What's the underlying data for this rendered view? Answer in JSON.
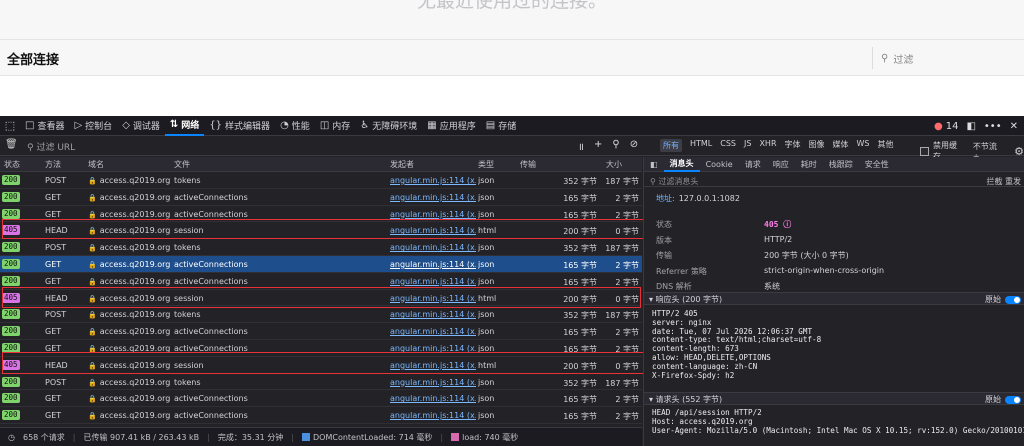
{
  "webpage": {
    "empty_text": "无最近使用过的连接。",
    "section_title": "全部连接",
    "filter_placeholder": "过滤"
  },
  "devtools": {
    "tabs": [
      {
        "icon": "□",
        "label": "查看器"
      },
      {
        "icon": "▷",
        "label": "控制台"
      },
      {
        "icon": "◇",
        "label": "调试器"
      },
      {
        "icon": "⇅",
        "label": "网络"
      },
      {
        "icon": "{}",
        "label": "样式编辑器"
      },
      {
        "icon": "◔",
        "label": "性能"
      },
      {
        "icon": "◫",
        "label": "内存"
      },
      {
        "icon": "♿",
        "label": "无障碍环境"
      },
      {
        "icon": "▦",
        "label": "应用程序"
      },
      {
        "icon": "▤",
        "label": "存储"
      }
    ],
    "error_count": "14",
    "filter_url_placeholder": "过滤 URL",
    "type_filters": [
      "所有",
      "HTML",
      "CSS",
      "JS",
      "XHR",
      "字体",
      "图像",
      "媒体",
      "WS",
      "其他"
    ],
    "disable_cache": "禁用缓存",
    "throttle": "不节流 ÷",
    "columns": {
      "status": "状态",
      "method": "方法",
      "domain": "域名",
      "file": "文件",
      "initiator": "发起者",
      "type": "类型",
      "transferred": "传输",
      "size": "大小"
    },
    "requests": [
      {
        "status": "200",
        "method": "POST",
        "domain": "access.q2019.org",
        "file": "tokens",
        "initiator": "angular.min.js:114 (x...",
        "type": "json",
        "transferred": "352 字节",
        "size": "187 字节"
      },
      {
        "status": "200",
        "method": "GET",
        "domain": "access.q2019.org",
        "file": "activeConnections",
        "initiator": "angular.min.js:114 (x...",
        "type": "json",
        "transferred": "165 字节",
        "size": "2 字节"
      },
      {
        "status": "200",
        "method": "GET",
        "domain": "access.q2019.org",
        "file": "activeConnections",
        "initiator": "angular.min.js:114 (x...",
        "type": "json",
        "transferred": "165 字节",
        "size": "2 字节"
      },
      {
        "status": "405",
        "method": "HEAD",
        "domain": "access.q2019.org",
        "file": "session",
        "initiator": "angular.min.js:114 (x...",
        "type": "html",
        "transferred": "200 字节",
        "size": "0 字节"
      },
      {
        "status": "200",
        "method": "POST",
        "domain": "access.q2019.org",
        "file": "tokens",
        "initiator": "angular.min.js:114 (x...",
        "type": "json",
        "transferred": "352 字节",
        "size": "187 字节"
      },
      {
        "status": "200",
        "method": "GET",
        "domain": "access.q2019.org",
        "file": "activeConnections",
        "initiator": "angular.min.js:114 (x...",
        "type": "json",
        "transferred": "165 字节",
        "size": "2 字节"
      },
      {
        "status": "200",
        "method": "GET",
        "domain": "access.q2019.org",
        "file": "activeConnections",
        "initiator": "angular.min.js:114 (x...",
        "type": "json",
        "transferred": "165 字节",
        "size": "2 字节"
      },
      {
        "status": "405",
        "method": "HEAD",
        "domain": "access.q2019.org",
        "file": "session",
        "initiator": "angular.min.js:114 (x...",
        "type": "html",
        "transferred": "200 字节",
        "size": "0 字节"
      },
      {
        "status": "200",
        "method": "POST",
        "domain": "access.q2019.org",
        "file": "tokens",
        "initiator": "angular.min.js:114 (x...",
        "type": "json",
        "transferred": "352 字节",
        "size": "187 字节"
      },
      {
        "status": "200",
        "method": "GET",
        "domain": "access.q2019.org",
        "file": "activeConnections",
        "initiator": "angular.min.js:114 (x...",
        "type": "json",
        "transferred": "165 字节",
        "size": "2 字节"
      },
      {
        "status": "200",
        "method": "GET",
        "domain": "access.q2019.org",
        "file": "activeConnections",
        "initiator": "angular.min.js:114 (x...",
        "type": "json",
        "transferred": "165 字节",
        "size": "2 字节"
      },
      {
        "status": "405",
        "method": "HEAD",
        "domain": "access.q2019.org",
        "file": "session",
        "initiator": "angular.min.js:114 (x...",
        "type": "html",
        "transferred": "200 字节",
        "size": "0 字节"
      },
      {
        "status": "200",
        "method": "POST",
        "domain": "access.q2019.org",
        "file": "tokens",
        "initiator": "angular.min.js:114 (x...",
        "type": "json",
        "transferred": "352 字节",
        "size": "187 字节"
      },
      {
        "status": "200",
        "method": "GET",
        "domain": "access.q2019.org",
        "file": "activeConnections",
        "initiator": "angular.min.js:114 (x...",
        "type": "json",
        "transferred": "165 字节",
        "size": "2 字节"
      },
      {
        "status": "200",
        "method": "GET",
        "domain": "access.q2019.org",
        "file": "activeConnections",
        "initiator": "angular.min.js:114 (x...",
        "type": "json",
        "transferred": "165 字节",
        "size": "2 字节"
      }
    ],
    "selected_row": 5,
    "statusbar": {
      "requests": "658 个请求",
      "transferred": "已传输 907.41 kB / 263.43 kB",
      "finish": "完成：35.31 分钟",
      "dcl": "DOMContentLoaded: 714 毫秒",
      "load": "load: 740 毫秒"
    },
    "details": {
      "tabs": [
        "消息头",
        "Cookie",
        "请求",
        "响应",
        "耗时",
        "栈跟踪",
        "安全性"
      ],
      "filter_placeholder": "过滤消息头",
      "filter_actions": "拦截  重发",
      "address_label": "地址:",
      "address_value": "127.0.0.1:1082",
      "fields": [
        {
          "key": "状态",
          "value": "405 ⓘ"
        },
        {
          "key": "版本",
          "value": "HTTP/2"
        },
        {
          "key": "传输",
          "value": "200 字节 (大小 0 字节)"
        },
        {
          "key": "Referrer 策略",
          "value": "strict-origin-when-cross-origin"
        },
        {
          "key": "DNS 解析",
          "value": "系统"
        }
      ],
      "response_headers_label": "▾ 响应头 (200 字节)",
      "raw_label": "原始",
      "response_headers_raw": "HTTP/2 405\nserver: nginx\ndate: Tue, 07 Jul 2026 12:06:37 GMT\ncontent-type: text/html;charset=utf-8\ncontent-length: 673\nallow: HEAD,DELETE,OPTIONS\ncontent-language: zh-CN\nX-Firefox-Spdy: h2",
      "request_headers_label": "▾ 请求头 (552 字节)",
      "request_headers_raw": "HEAD /api/session HTTP/2\nHost: access.q2019.org\nUser-Agent: Mozilla/5.0 (Macintosh; Intel Mac OS X 10.15; rv:152.0) Gecko/20100101"
    }
  }
}
